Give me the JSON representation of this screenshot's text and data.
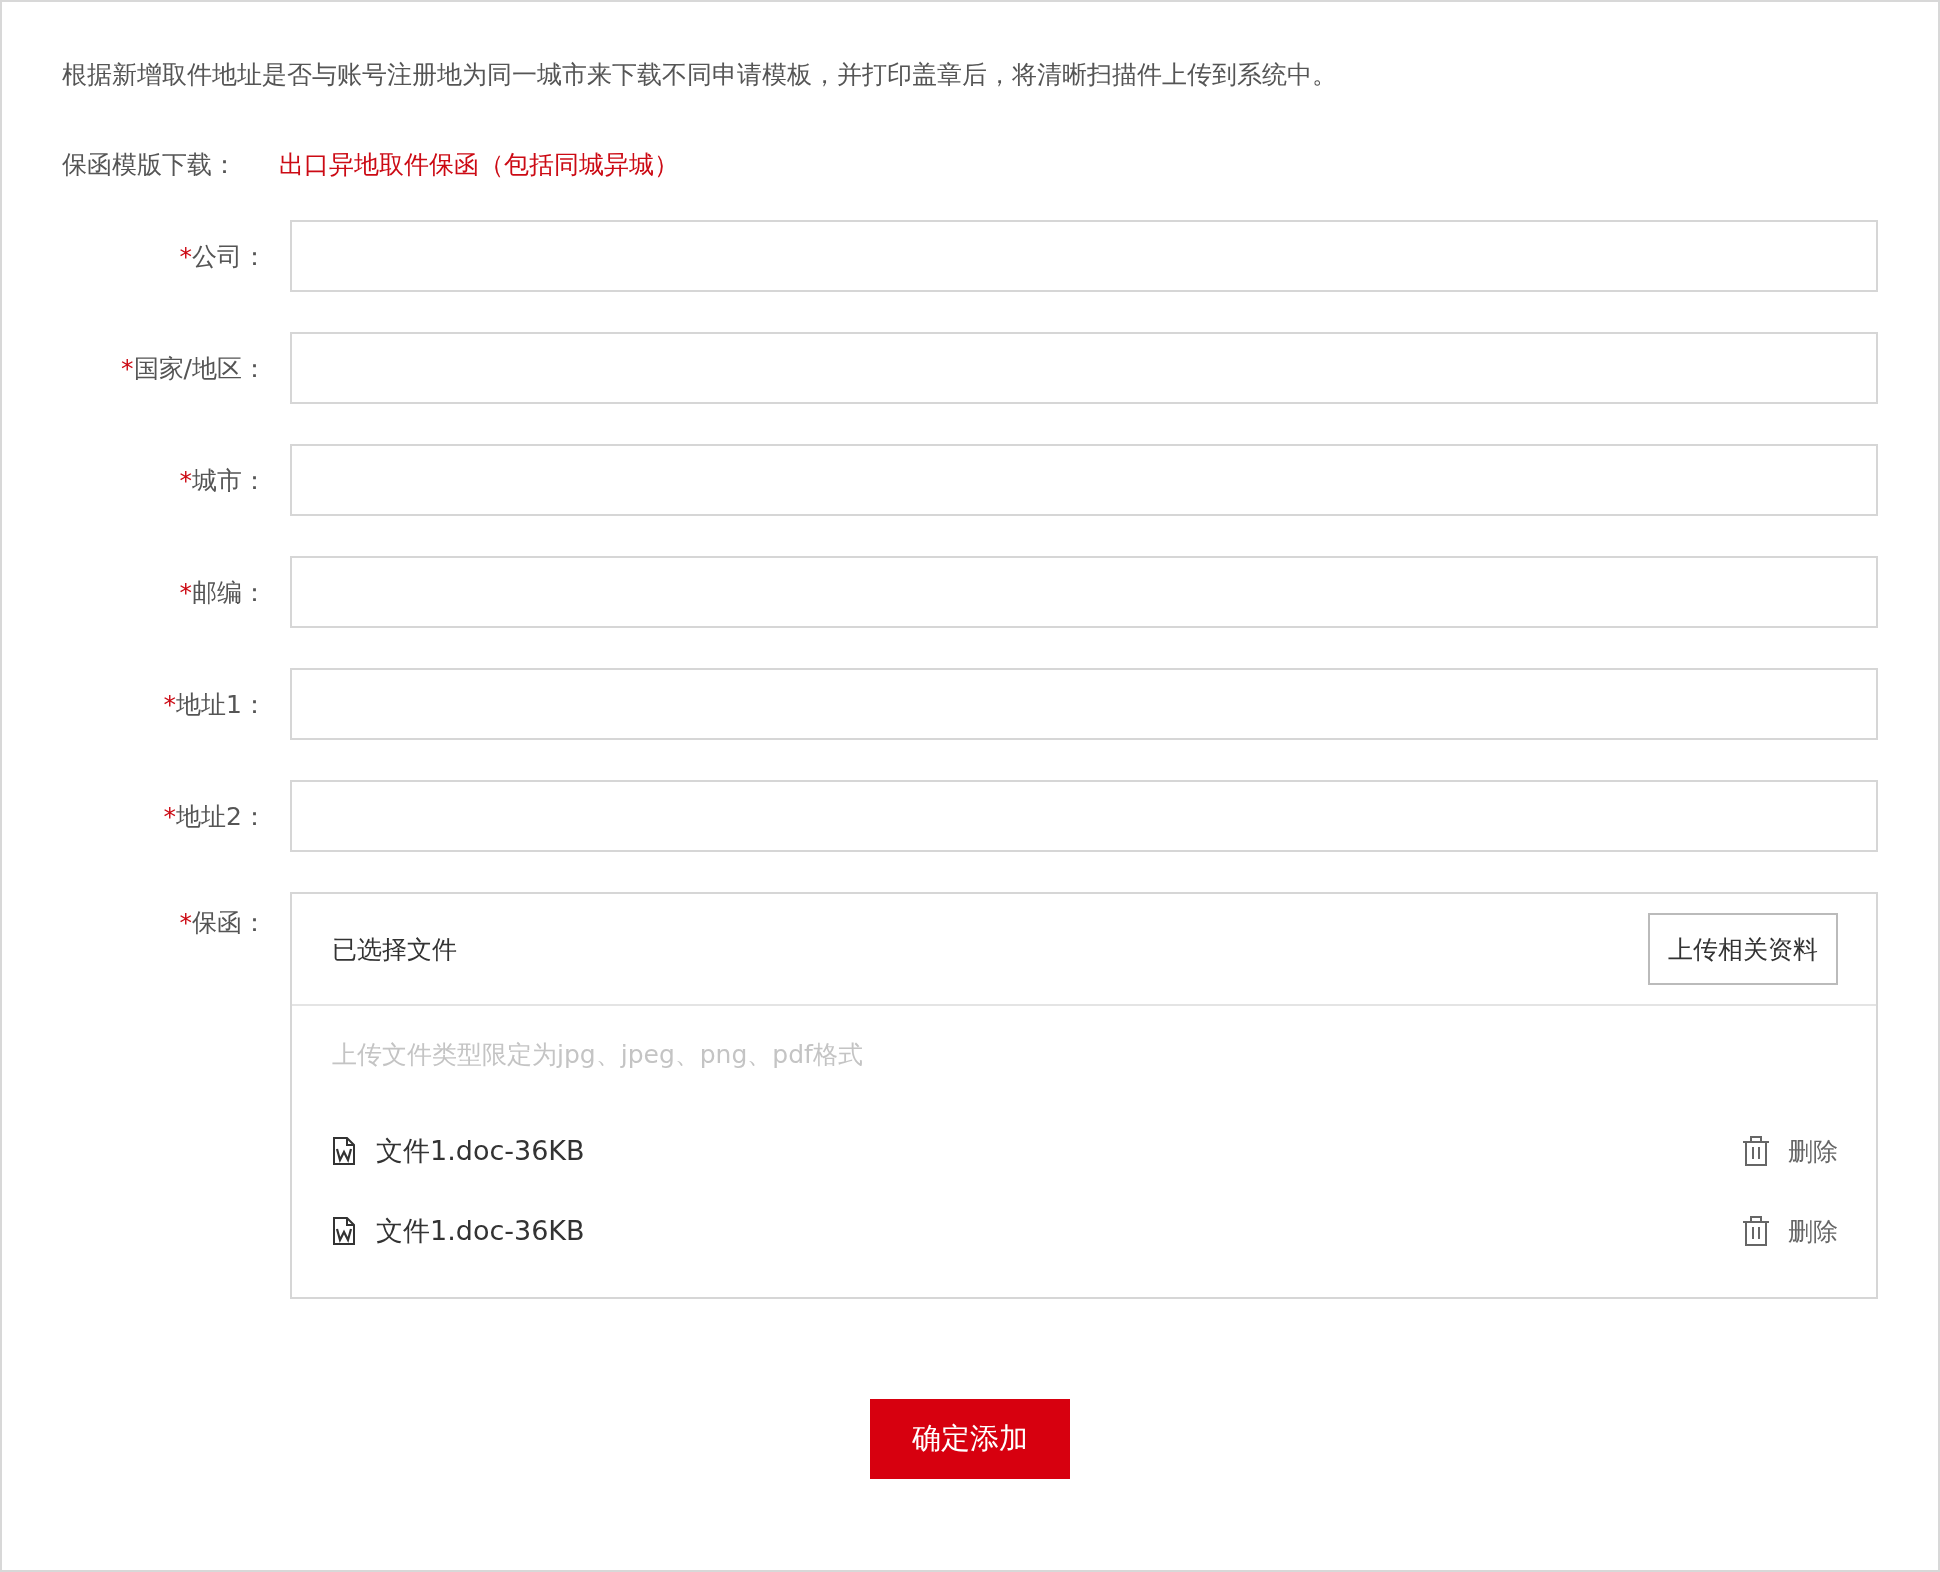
{
  "intro": "根据新增取件地址是否与账号注册地为同一城市来下载不同申请模板，并打印盖章后，将清晰扫描件上传到系统中。",
  "template": {
    "label": "保函模版下载：",
    "link": "出口异地取件保函（包括同城异城）"
  },
  "fields": [
    {
      "label": "公司：",
      "required_mark": "*"
    },
    {
      "label": "国家/地区：",
      "required_mark": "*"
    },
    {
      "label": "城市：",
      "required_mark": "*"
    },
    {
      "label": "邮编：",
      "required_mark": "*"
    },
    {
      "label": "地址1：",
      "required_mark": "*"
    },
    {
      "label": "地址2：",
      "required_mark": "*"
    }
  ],
  "upload": {
    "label": "保函：",
    "required_mark": "*",
    "title": "已选择文件",
    "button": "上传相关资料",
    "hint": "上传文件类型限定为jpg、jpeg、png、pdf格式",
    "files": [
      {
        "name": "文件1.doc-36KB",
        "action": "删除"
      },
      {
        "name": "文件1.doc-36KB",
        "action": "删除"
      }
    ]
  },
  "submit": "确定添加"
}
